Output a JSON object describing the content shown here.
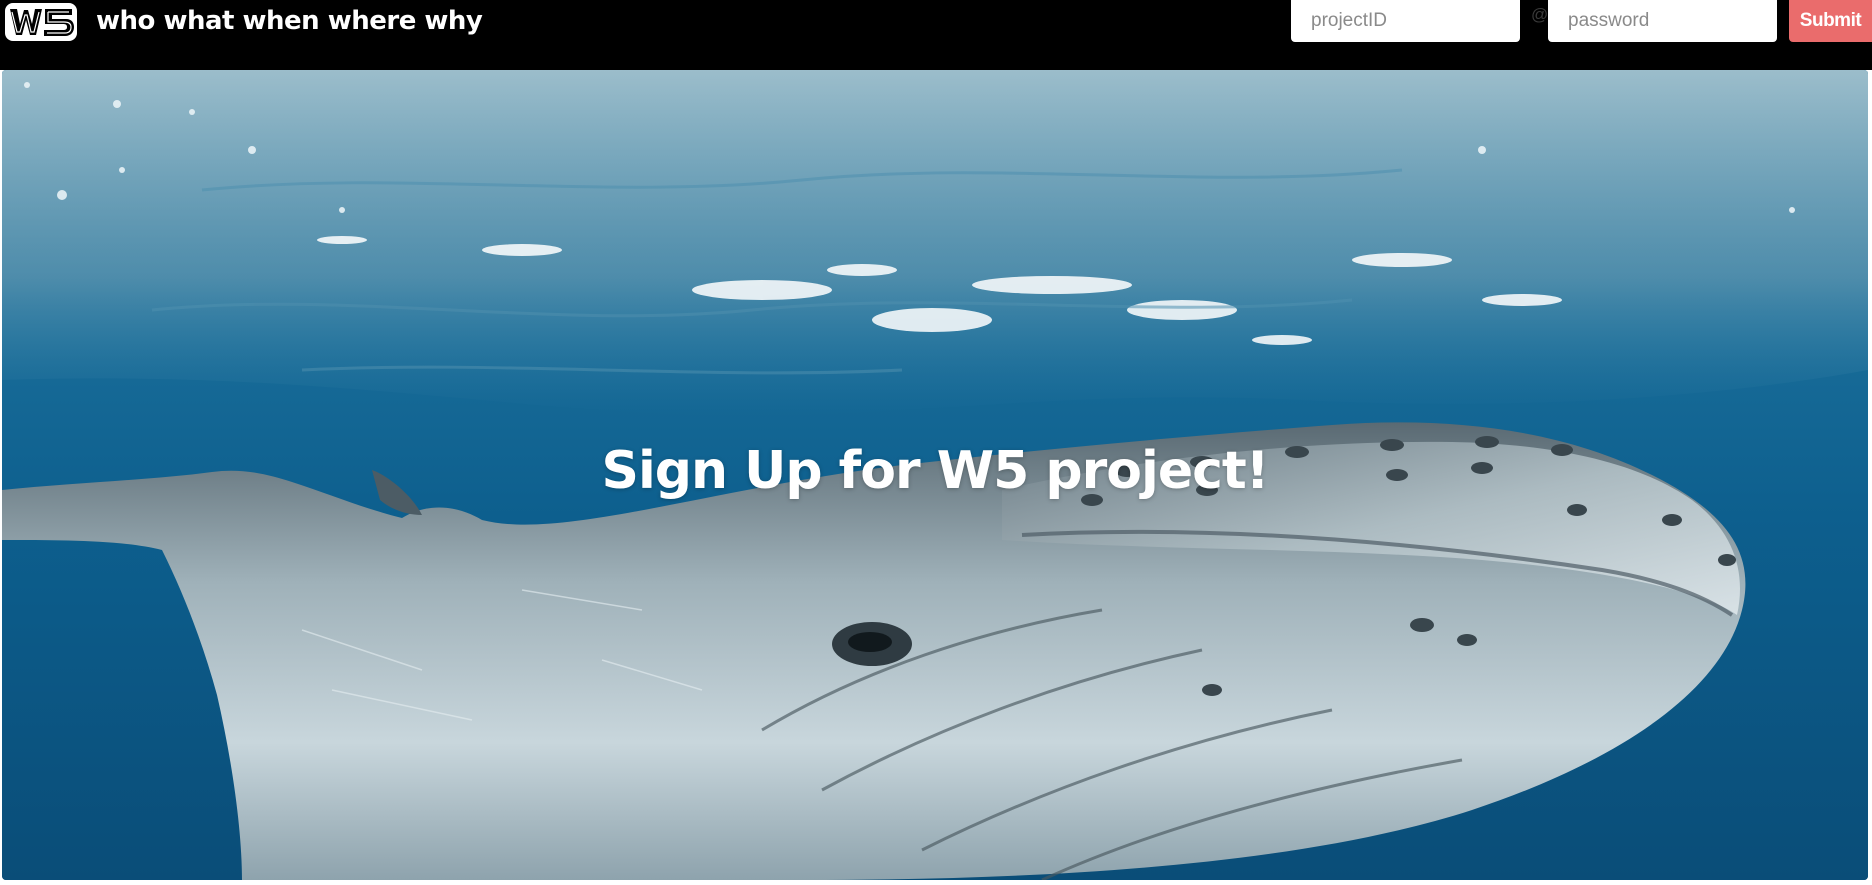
{
  "header": {
    "logo_text": "W5",
    "title": "who what when where why"
  },
  "login": {
    "project_id_placeholder": "projectID",
    "at_symbol": "@",
    "password_placeholder": "password",
    "submit_label": "Submit"
  },
  "hero": {
    "heading": "Sign Up for W5 project!"
  },
  "colors": {
    "navbar": "#000000",
    "submit": "#ea6c6c",
    "ocean": "#0a4f78"
  }
}
